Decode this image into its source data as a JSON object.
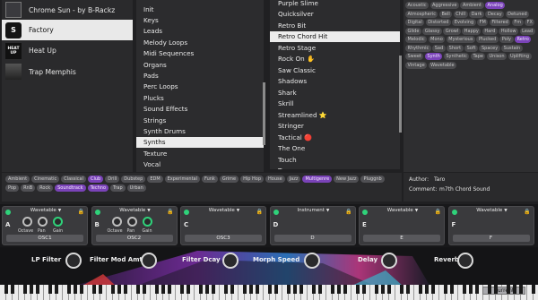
{
  "banks": [
    {
      "name": "Chrome Sun - by B-Rackz",
      "logo": "",
      "selected": false
    },
    {
      "name": "Factory",
      "logo": "S",
      "selected": true
    },
    {
      "name": "Heat Up",
      "logo": "HEAT UP",
      "selected": false
    },
    {
      "name": "Trap Memphis",
      "logo": "",
      "selected": false
    }
  ],
  "categories": [
    "Init",
    "Keys",
    "Leads",
    "Melody Loops",
    "Midi Sequences",
    "Organs",
    "Pads",
    "Perc Loops",
    "Plucks",
    "Sound Effects",
    "Strings",
    "Synth Drums",
    "Synths",
    "Texture",
    "Vocal"
  ],
  "selected_category": "Synths",
  "presets": [
    "Purple Slime",
    "Quicksilver",
    "Retro Bit",
    "Retro Chord Hit",
    "Retro Stage",
    "Rock On ✋",
    "Saw Classic",
    "Shadows",
    "Shark",
    "Skrill",
    "Streamlined ⭐",
    "Stringer",
    "Tactical 🔴",
    "The One",
    "Touch",
    "Tron"
  ],
  "selected_preset": "Retro Chord Hit",
  "tags": [
    {
      "t": "Acoustic",
      "on": false
    },
    {
      "t": "Aggressive",
      "on": false
    },
    {
      "t": "Ambient",
      "on": false
    },
    {
      "t": "Analog",
      "on": true
    },
    {
      "t": "Atmospheric",
      "on": false
    },
    {
      "t": "Bell",
      "on": false
    },
    {
      "t": "Chill",
      "on": false
    },
    {
      "t": "Dark",
      "on": false
    },
    {
      "t": "Decay",
      "on": false
    },
    {
      "t": "Detuned",
      "on": false
    },
    {
      "t": "Digital",
      "on": false
    },
    {
      "t": "Distorted",
      "on": false
    },
    {
      "t": "Evolving",
      "on": false
    },
    {
      "t": "FM",
      "on": false
    },
    {
      "t": "Filtered",
      "on": false
    },
    {
      "t": "Fm",
      "on": false
    },
    {
      "t": "FX",
      "on": false
    },
    {
      "t": "Glide",
      "on": false
    },
    {
      "t": "Glassy",
      "on": false
    },
    {
      "t": "Growl",
      "on": false
    },
    {
      "t": "Happy",
      "on": false
    },
    {
      "t": "Hard",
      "on": false
    },
    {
      "t": "Hollow",
      "on": false
    },
    {
      "t": "Lead",
      "on": false
    },
    {
      "t": "Melodic",
      "on": false
    },
    {
      "t": "Mono",
      "on": false
    },
    {
      "t": "Mysterious",
      "on": false
    },
    {
      "t": "Plucked",
      "on": false
    },
    {
      "t": "Poly",
      "on": false
    },
    {
      "t": "Retro",
      "on": true
    },
    {
      "t": "Rhythmic",
      "on": false
    },
    {
      "t": "Sad",
      "on": false
    },
    {
      "t": "Short",
      "on": false
    },
    {
      "t": "Soft",
      "on": false
    },
    {
      "t": "Spacey",
      "on": false
    },
    {
      "t": "Sustain",
      "on": false
    },
    {
      "t": "Sweet",
      "on": false
    },
    {
      "t": "Synth",
      "on": true
    },
    {
      "t": "Synthetic",
      "on": false
    },
    {
      "t": "Tape",
      "on": false
    },
    {
      "t": "Unison",
      "on": false
    },
    {
      "t": "Uplifting",
      "on": false
    },
    {
      "t": "Vintage",
      "on": false
    },
    {
      "t": "Wavetable",
      "on": false
    }
  ],
  "genres": [
    {
      "t": "Ambient",
      "on": false
    },
    {
      "t": "Cinematic",
      "on": false
    },
    {
      "t": "Classical",
      "on": false
    },
    {
      "t": "Club",
      "on": true
    },
    {
      "t": "Drill",
      "on": false
    },
    {
      "t": "Dubstep",
      "on": false
    },
    {
      "t": "EDM",
      "on": false
    },
    {
      "t": "Experimental",
      "on": false
    },
    {
      "t": "Funk",
      "on": false
    },
    {
      "t": "Grime",
      "on": false
    },
    {
      "t": "Hip Hop",
      "on": false
    },
    {
      "t": "House",
      "on": false
    },
    {
      "t": "Jazz",
      "on": false
    },
    {
      "t": "Multigenre",
      "on": true
    },
    {
      "t": "New Jazz",
      "on": false
    },
    {
      "t": "Pluggnb",
      "on": false
    },
    {
      "t": "Pop",
      "on": false
    },
    {
      "t": "RnB",
      "on": false
    },
    {
      "t": "Rock",
      "on": false
    },
    {
      "t": "Soundtrack",
      "on": true
    },
    {
      "t": "Techno",
      "on": true
    },
    {
      "t": "Trap",
      "on": false
    },
    {
      "t": "Urban",
      "on": false
    }
  ],
  "info": {
    "author_label": "Author:",
    "author": "Taro",
    "comment_label": "Comment:",
    "comment": "m7th Chord Sound"
  },
  "oscillators": [
    {
      "letter": "A",
      "type": "Wavetable",
      "name": "OSC1",
      "knobs": [
        "Octave",
        "Pan",
        "Gain"
      ]
    },
    {
      "letter": "B",
      "type": "Wavetable",
      "name": "OSC2",
      "knobs": [
        "Octave",
        "Pan",
        "Gain"
      ]
    },
    {
      "letter": "C",
      "type": "Wavetable",
      "name": "OSC3",
      "knobs": []
    },
    {
      "letter": "D",
      "type": "Instrument",
      "name": "D",
      "knobs": []
    },
    {
      "letter": "E",
      "type": "Wavetable",
      "name": "E",
      "knobs": []
    },
    {
      "letter": "F",
      "type": "Wavetable",
      "name": "F",
      "knobs": []
    }
  ],
  "macros": [
    "LP Filter",
    "Filter Mod Amt",
    "Filter Dcay",
    "Morph Speed",
    "Delay",
    "Reverb"
  ],
  "current_label": "Current",
  "colors": {
    "accent": "#7a43b8",
    "led": "#2fd27a"
  }
}
